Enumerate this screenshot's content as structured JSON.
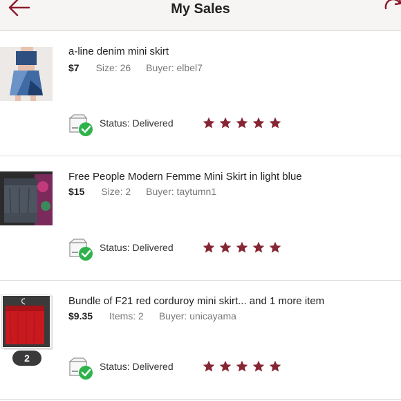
{
  "header": {
    "title": "My Sales"
  },
  "colors": {
    "star": "#862634",
    "check": "#2db34a",
    "divider": "#dcdcdc",
    "back_arrow": "#8a1c2c"
  },
  "items": [
    {
      "title": "a-line denim mini skirt",
      "price": "$7",
      "detail": "Size: 26",
      "buyer": "Buyer: elbel7",
      "status": "Status:  Delivered",
      "rating": 5
    },
    {
      "title": "Free People Modern Femme Mini Skirt in light blue",
      "price": "$15",
      "detail": "Size: 2",
      "buyer": "Buyer: taytumn1",
      "status": "Status:  Delivered",
      "rating": 5
    },
    {
      "title": "Bundle of F21 red corduroy mini skirt... and 1 more item",
      "price": "$9.35",
      "detail": "Items: 2",
      "buyer": "Buyer: unicayama",
      "status": "Status:  Delivered",
      "rating": 5,
      "bundle_count": "2"
    }
  ]
}
